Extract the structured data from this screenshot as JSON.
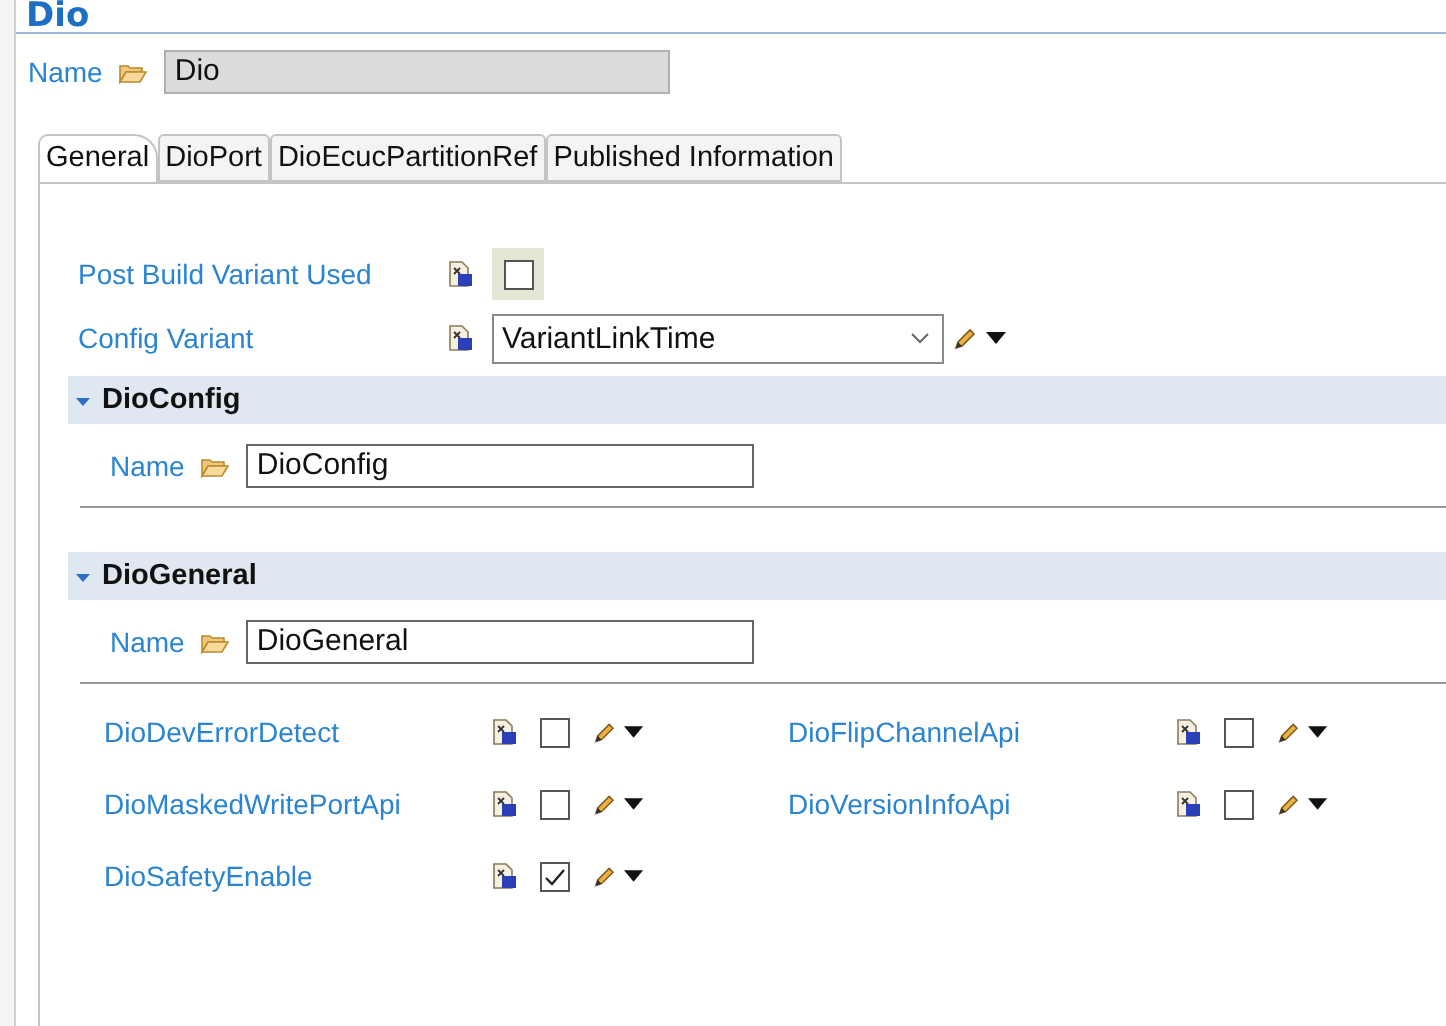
{
  "editor": {
    "title": "Dio",
    "name_label": "Name",
    "name_value": "Dio"
  },
  "tabs": [
    {
      "label": "General",
      "selected": true
    },
    {
      "label": "DioPort",
      "selected": false
    },
    {
      "label": "DioEcucPartitionRef",
      "selected": false
    },
    {
      "label": "Published Information",
      "selected": false
    }
  ],
  "general": {
    "post_build": {
      "label": "Post Build Variant Used",
      "checked": false
    },
    "config_variant": {
      "label": "Config Variant",
      "value": "VariantLinkTime"
    }
  },
  "sections": [
    {
      "title": "DioConfig",
      "expanded": true,
      "name_label": "Name",
      "name_value": "DioConfig"
    },
    {
      "title": "DioGeneral",
      "expanded": true,
      "name_label": "Name",
      "name_value": "DioGeneral",
      "params": [
        {
          "label": "DioDevErrorDetect",
          "checked": false
        },
        {
          "label": "DioFlipChannelApi",
          "checked": false
        },
        {
          "label": "DioMaskedWritePortApi",
          "checked": false
        },
        {
          "label": "DioVersionInfoApi",
          "checked": false
        },
        {
          "label": "DioSafetyEnable",
          "checked": true
        }
      ]
    }
  ]
}
